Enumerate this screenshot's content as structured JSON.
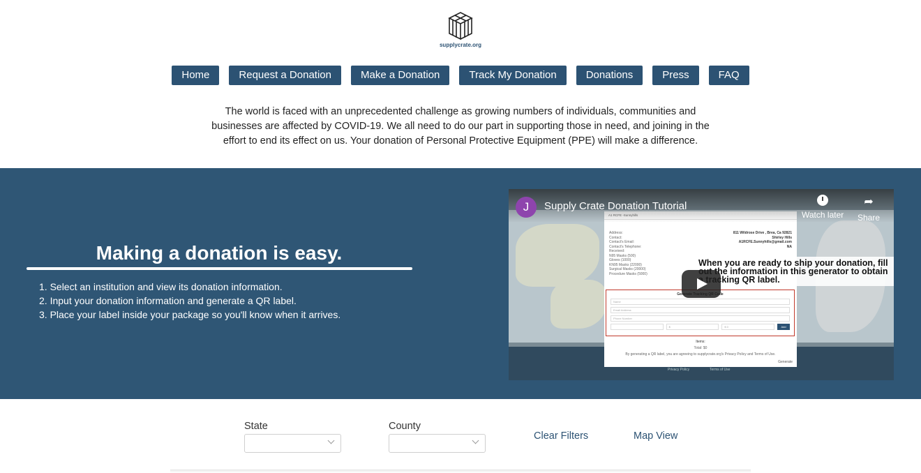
{
  "logo": {
    "text": "supplycrate.org"
  },
  "nav": [
    {
      "label": "Home"
    },
    {
      "label": "Request a Donation"
    },
    {
      "label": "Make a Donation"
    },
    {
      "label": "Track My Donation"
    },
    {
      "label": "Donations"
    },
    {
      "label": "Press"
    },
    {
      "label": "FAQ"
    }
  ],
  "intro": {
    "text": "The world is faced with an unprecedented challenge as growing numbers of individuals, communities and businesses are affected by COVID-19. We all need to do our part in supporting those in need, and joining in the effort to end its effect on us. Your donation of Personal Protective Equipment (PPE) will make a difference."
  },
  "band": {
    "title": "Making a donation is easy.",
    "steps": [
      "1. Select an institution and view its donation information.",
      "2. Input your donation information and generate a QR label.",
      "3. Place your label inside your package so you'll know when it arrives."
    ]
  },
  "video": {
    "avatar_letter": "J",
    "title": "Supply Crate Donation Tutorial",
    "watch_later": "Watch later",
    "share": "Share",
    "overlay": "When you are ready to ship your donation, fill out the information in this generator to obtain a tracking QR label.",
    "panel": {
      "heading": "A1 RCFE -Sunnyhills",
      "rows": [
        {
          "k": "Address:",
          "v": "811 Wildrose Drive , Brea, Ca 92821"
        },
        {
          "k": "Contact:",
          "v": "Shirley Hills"
        },
        {
          "k": "Contact's Email:",
          "v": "A1RCFE.Sunnyhills@gmail.com"
        },
        {
          "k": "Contact's Telephone:",
          "v": "NA"
        },
        {
          "k": "Received:",
          "v": ""
        },
        {
          "k": "N95 Masks (500)",
          "v": ""
        },
        {
          "k": "Gloves (1000)",
          "v": ""
        },
        {
          "k": "KN95 Masks (22000)",
          "v": ""
        },
        {
          "k": "Surgical Masks (20000)",
          "v": ""
        },
        {
          "k": "Procedure Masks (5000)",
          "v": ""
        }
      ],
      "gen_title": "Generate Tracking QR Code",
      "name_ph": "Name",
      "email_ph": "Email Address",
      "phone_ph": "Phone Number",
      "qty_ph": "$",
      "price_ph": "$ 0",
      "add": "Add",
      "items": "Items:",
      "total": "Total: $0",
      "agree": "By generating a QR label, you are agreeing to supplycrate.org's Privacy Policy and Terms of Use.",
      "generate": "Generate"
    },
    "footer_privacy": "Privacy Policy",
    "footer_terms": "Terms of Use"
  },
  "filters": {
    "state_label": "State",
    "county_label": "County",
    "clear": "Clear Filters",
    "map": "Map View"
  },
  "colors": {
    "brand": "#2c5273",
    "band": "#2f5675"
  }
}
